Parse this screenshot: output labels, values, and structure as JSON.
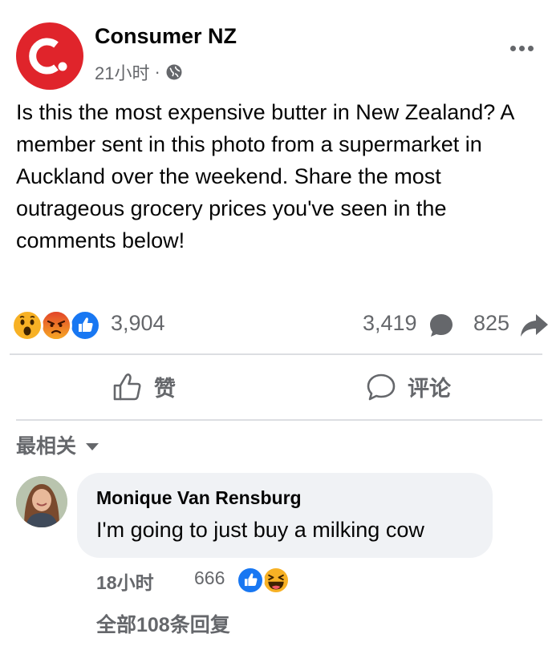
{
  "post": {
    "page_name": "Consumer NZ",
    "logo_icon": "consumer-nz-logo",
    "time": "21小时",
    "separator": "·",
    "audience_icon": "globe-icon",
    "text": "Is this the most expensive butter in New Zealand? A member sent in this photo from a supermarket in Auckland over the weekend. Share the most outrageous grocery prices you've seen in the comments below!",
    "brand_color": "#e0242b"
  },
  "stats": {
    "reaction_icons": [
      "wow-icon",
      "angry-icon",
      "like-icon"
    ],
    "reaction_count": "3,904",
    "comment_count": "3,419",
    "share_count": "825"
  },
  "actions": {
    "like_label": "赞",
    "comment_label": "评论"
  },
  "sort": {
    "label": "最相关"
  },
  "comment": {
    "author": "Monique Van Rensburg",
    "text": "I'm going to just buy a milking cow",
    "time": "18小时",
    "reaction_count": "666",
    "reaction_icons": [
      "like-icon",
      "haha-icon"
    ]
  },
  "replies": {
    "label": "全部108条回复"
  }
}
